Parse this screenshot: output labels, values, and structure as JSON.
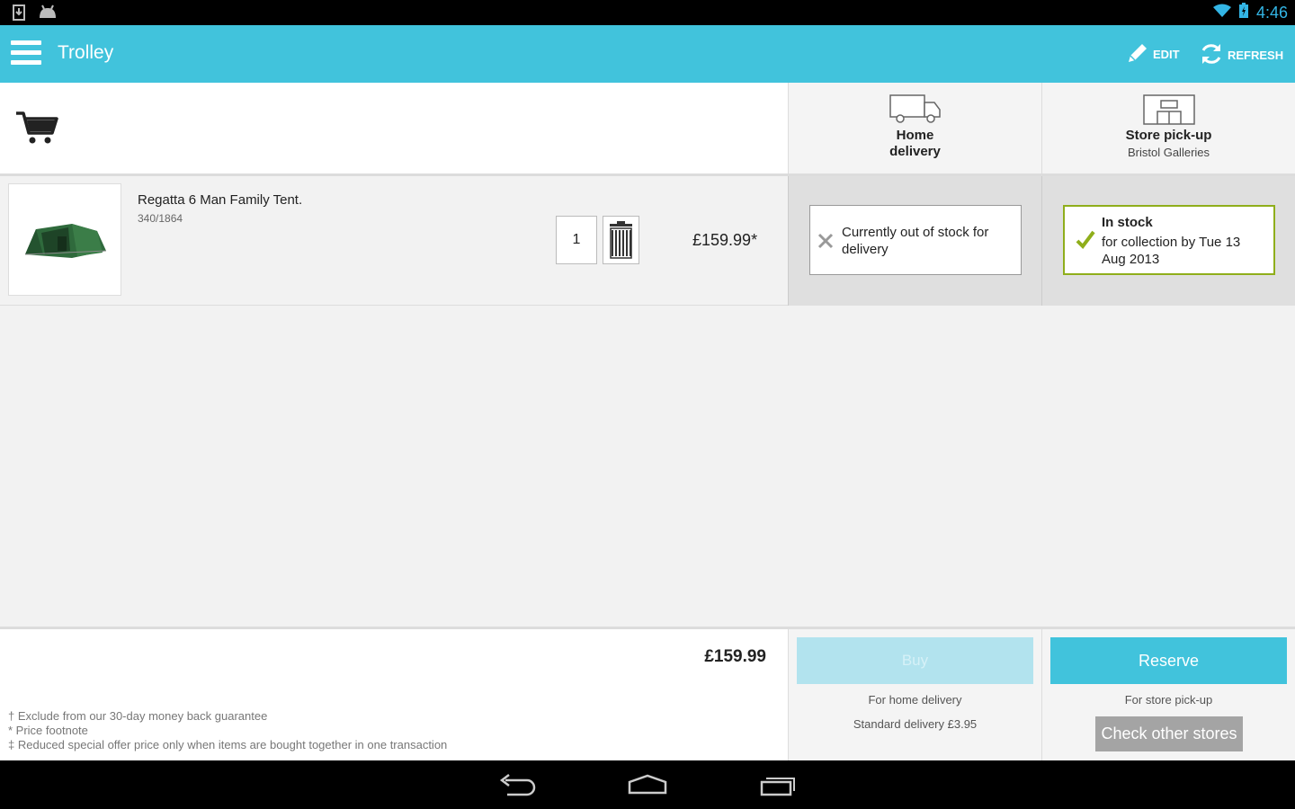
{
  "status_bar": {
    "time": "4:46"
  },
  "action_bar": {
    "title": "Trolley",
    "edit_label": "EDIT",
    "refresh_label": "REFRESH"
  },
  "columns": {
    "home": {
      "label_line1": "Home",
      "label_line2": "delivery"
    },
    "store": {
      "label": "Store pick-up",
      "store_name": "Bristol Galleries"
    }
  },
  "item": {
    "name": "Regatta 6 Man Family Tent.",
    "code": "340/1864",
    "quantity": "1",
    "price": "£159.99*",
    "delivery_status": "Currently out of stock for delivery",
    "pickup_status_title": "In stock",
    "pickup_status_text": "for collection by Tue 13 Aug 2013"
  },
  "footer": {
    "total": "£159.99",
    "footnotes": [
      "† Exclude from our 30-day money back guarantee",
      "* Price footnote",
      "‡ Reduced special offer price only when items are bought together in one transaction"
    ],
    "buy_label": "Buy",
    "home_caption": "For home delivery",
    "delivery_cost": "Standard delivery £3.95",
    "reserve_label": "Reserve",
    "store_caption": "For store pick-up",
    "check_stores_label": "Check other stores"
  },
  "colors": {
    "accent": "#41c3dc",
    "buy_disabled": "#b2e3ee",
    "in_stock_border": "#8fae1b",
    "check_stores_bg": "#a4a4a4"
  }
}
